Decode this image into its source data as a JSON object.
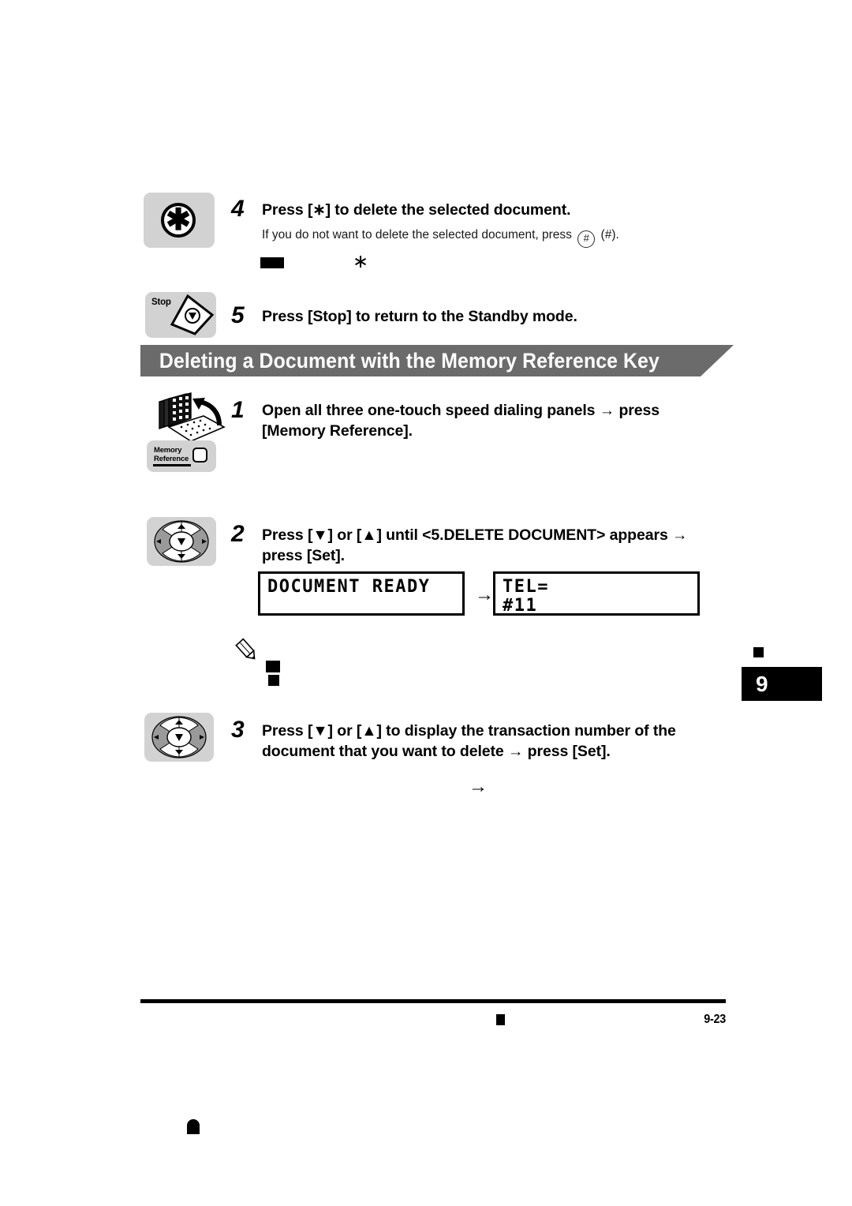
{
  "page": {
    "number": "9-23",
    "chapter_tab": "9"
  },
  "steps": [
    {
      "number": "4",
      "title": "Press [∗] to delete the selected document.",
      "body": "If you do not want to delete the selected document, press",
      "body_tail": "(#).",
      "icon": "asterisk-key-icon"
    },
    {
      "number": "5",
      "title": "Press [Stop] to return to the Standby mode.",
      "icon": "stop-key-icon",
      "icon_label": "Stop"
    },
    {
      "number": "1",
      "title": "Open all three one-touch speed dialing panels → press [Memory Reference].",
      "icon": "memory-reference-key-icon",
      "icon_label_line1": "Memory",
      "icon_label_line2": "Reference"
    },
    {
      "number": "2",
      "title": "Press [▼] or [▲] until <5.DELETE DOCUMENT> appears → press [Set].",
      "icon": "arrow-pad-icon"
    },
    {
      "number": "3",
      "title": "Press [▼] or [▲] to display the transaction number of the document that you want to delete → press [Set].",
      "icon": "arrow-pad-icon"
    }
  ],
  "section_banner": {
    "title": "Deleting a Document with the Memory Reference Key"
  },
  "lcd_displays": [
    {
      "name": "display-left",
      "line1": "DOCUMENT READY",
      "line2": ""
    },
    {
      "name": "display-right",
      "line1": "TEL=",
      "line2": "#11"
    }
  ],
  "lcd_transition_arrow": "→",
  "note": {
    "icon": "pencil-note-icon",
    "bullet1": "",
    "bullet2": ""
  },
  "inline_glyphs": {
    "asterisk": "∗",
    "hash_circle": "#",
    "hash_plain": "(#).",
    "standalone_arrow": "→"
  },
  "colors": {
    "banner_gray": "#6b6b6b",
    "key_tile_gray": "#d2d2d2",
    "black": "#000000",
    "white": "#ffffff"
  }
}
